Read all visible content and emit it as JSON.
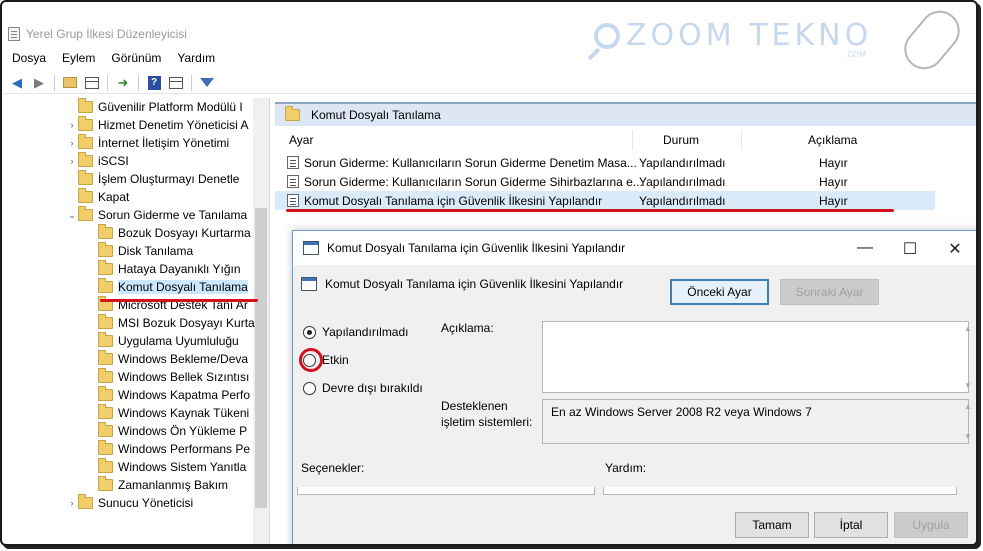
{
  "window": {
    "title": "Yerel Grup İlkesi Düzenleyicisi"
  },
  "watermark": {
    "text": "ZOOM TEKNO",
    "sub": ".COM"
  },
  "menu": [
    "Dosya",
    "Eylem",
    "Görünüm",
    "Yardım"
  ],
  "toolbar": {
    "icons": [
      "back-arrow-icon",
      "forward-arrow-icon",
      "up-folder-icon",
      "show-hide-tree-icon",
      "export-list-icon",
      "help-icon",
      "properties-icon",
      "filter-icon"
    ]
  },
  "tree": {
    "items": [
      {
        "label": "Güvenilir Platform Modülü I",
        "indent": 1,
        "expander": "",
        "selected": false
      },
      {
        "label": "Hizmet Denetim Yöneticisi A",
        "indent": 1,
        "expander": ">",
        "selected": false
      },
      {
        "label": "İnternet İletişim Yönetimi",
        "indent": 1,
        "expander": ">",
        "selected": false
      },
      {
        "label": "iSCSI",
        "indent": 1,
        "expander": ">",
        "selected": false
      },
      {
        "label": "İşlem Oluşturmayı Denetle",
        "indent": 1,
        "expander": "",
        "selected": false
      },
      {
        "label": "Kapat",
        "indent": 1,
        "expander": "",
        "selected": false
      },
      {
        "label": "Sorun Giderme ve Tanılama",
        "indent": 1,
        "expander": "v",
        "selected": false
      },
      {
        "label": "Bozuk Dosyayı Kurtarma",
        "indent": 2,
        "expander": "",
        "selected": false
      },
      {
        "label": "Disk Tanılama",
        "indent": 2,
        "expander": "",
        "selected": false
      },
      {
        "label": "Hataya Dayanıklı Yığın",
        "indent": 2,
        "expander": "",
        "selected": false
      },
      {
        "label": "Komut Dosyalı Tanılama",
        "indent": 2,
        "expander": "",
        "selected": true
      },
      {
        "label": "Microsoft Destek Tanı Ar",
        "indent": 2,
        "expander": "",
        "selected": false
      },
      {
        "label": "MSI Bozuk Dosyayı Kurta",
        "indent": 2,
        "expander": "",
        "selected": false
      },
      {
        "label": "Uygulama Uyumluluğu",
        "indent": 2,
        "expander": "",
        "selected": false
      },
      {
        "label": "Windows Bekleme/Deva",
        "indent": 2,
        "expander": "",
        "selected": false
      },
      {
        "label": "Windows Bellek Sızıntısı",
        "indent": 2,
        "expander": "",
        "selected": false
      },
      {
        "label": "Windows Kapatma Perfo",
        "indent": 2,
        "expander": "",
        "selected": false
      },
      {
        "label": "Windows Kaynak Tükeni",
        "indent": 2,
        "expander": "",
        "selected": false
      },
      {
        "label": "Windows Ön Yükleme P",
        "indent": 2,
        "expander": "",
        "selected": false
      },
      {
        "label": "Windows Performans Pe",
        "indent": 2,
        "expander": "",
        "selected": false
      },
      {
        "label": "Windows Sistem Yanıtla",
        "indent": 2,
        "expander": "",
        "selected": false
      },
      {
        "label": "Zamanlanmış Bakım",
        "indent": 2,
        "expander": "",
        "selected": false
      },
      {
        "label": "Sunucu Yöneticisi",
        "indent": 1,
        "expander": ">",
        "selected": false
      }
    ]
  },
  "panel": {
    "header": "Komut Dosyalı Tanılama",
    "columns": {
      "setting": "Ayar",
      "state": "Durum",
      "comment": "Açıklama"
    },
    "rows": [
      {
        "setting": "Sorun Giderme: Kullanıcıların Sorun Giderme Denetim Masa...",
        "state": "Yapılandırılmadı",
        "comment": "Hayır"
      },
      {
        "setting": "Sorun Giderme: Kullanıcıların Sorun Giderme Sihirbazlarına e...",
        "state": "Yapılandırılmadı",
        "comment": "Hayır"
      },
      {
        "setting": "Komut Dosyalı Tanılama için Güvenlik İlkesini Yapılandır",
        "state": "Yapılandırılmadı",
        "comment": "Hayır"
      }
    ]
  },
  "dialog": {
    "title": "Komut Dosyalı Tanılama için Güvenlik İlkesini Yapılandır",
    "subtitle": "Komut Dosyalı Tanılama için Güvenlik İlkesini Yapılandır",
    "prev_button": "Önceki Ayar",
    "next_button": "Sonraki Ayar",
    "radios": [
      {
        "label": "Yapılandırılmadı",
        "checked": true
      },
      {
        "label": "Etkin",
        "checked": false
      },
      {
        "label": "Devre dışı bırakıldı",
        "checked": false
      }
    ],
    "comment_label": "Açıklama:",
    "supported_label_1": "Desteklenen",
    "supported_label_2": "işletim sistemleri:",
    "supported_value": "En az Windows Server 2008 R2 veya Windows 7",
    "options_label": "Seçenekler:",
    "help_label": "Yardım:",
    "ok_button": "Tamam",
    "cancel_button": "İptal",
    "apply_button": "Uygula"
  },
  "colors": {
    "annotation_red": "#d1121c",
    "selection": "#cce8ff",
    "header_band": "#dce6f4"
  }
}
